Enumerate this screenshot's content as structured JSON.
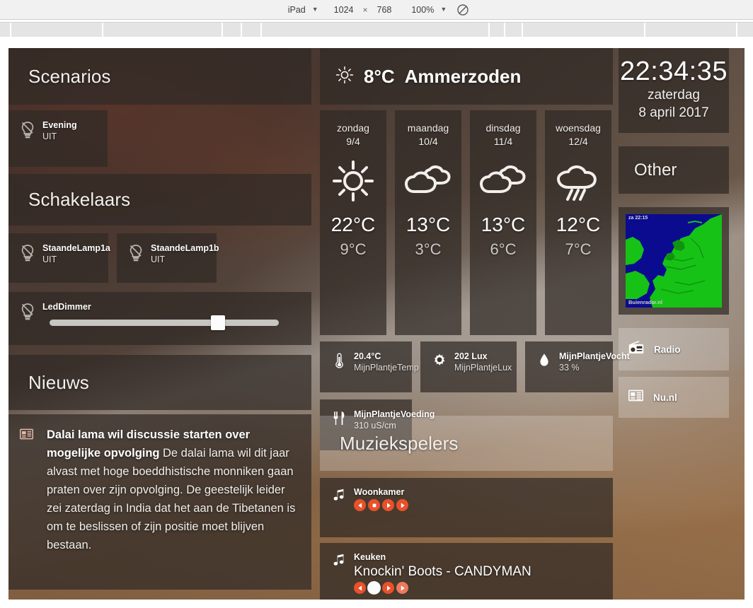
{
  "devtoolbar": {
    "device": "iPad",
    "device_caret": "▼",
    "width": "1024",
    "times": "×",
    "height": "768",
    "zoom": "100%",
    "zoom_caret": "▼",
    "rotate_icon": "rotate-icon"
  },
  "ruler": {
    "ticks": [
      14,
      144,
      313,
      340,
      368,
      690,
      712,
      737,
      910,
      1040
    ]
  },
  "scenarios": {
    "header": "Scenarios",
    "items": [
      {
        "name": "Evening",
        "state": "UIT",
        "icon": "bulb-icon"
      }
    ]
  },
  "switches": {
    "header": "Schakelaars",
    "items": [
      {
        "name": "StaandeLamp1a",
        "state": "UIT",
        "icon": "bulb-icon"
      },
      {
        "name": "StaandeLamp1b",
        "state": "UIT",
        "icon": "bulb-icon"
      }
    ],
    "dimmer": {
      "name": "LedDimmer",
      "icon": "bulb-icon",
      "value_percent": 75
    }
  },
  "weather": {
    "icon": "sun-icon",
    "current_temp": "8°C",
    "city": "Ammerzoden",
    "forecast": [
      {
        "day": "zondag",
        "date": "9/4",
        "icon": "sun-icon",
        "high": "22°C",
        "low": "9°C"
      },
      {
        "day": "maandag",
        "date": "10/4",
        "icon": "clouds-icon",
        "high": "13°C",
        "low": "3°C"
      },
      {
        "day": "dinsdag",
        "date": "11/4",
        "icon": "clouds-icon",
        "high": "13°C",
        "low": "6°C"
      },
      {
        "day": "woensdag",
        "date": "12/4",
        "icon": "rain-icon",
        "high": "12°C",
        "low": "7°C"
      }
    ]
  },
  "sensors": [
    {
      "value": "20.4°C",
      "label": "MijnPlantjeTemp",
      "icon": "thermometer-icon"
    },
    {
      "value": "202 Lux",
      "label": "MijnPlantjeLux",
      "icon": "brightness-icon"
    },
    {
      "value": "MijnPlantjeVocht",
      "label": "33 %",
      "icon": "droplet-icon"
    },
    {
      "value": "MijnPlantjeVoeding",
      "label": "310 uS/cm",
      "icon": "cutlery-icon"
    }
  ],
  "clock": {
    "time": "22:34:35",
    "weekday": "zaterdag",
    "date": "8 april 2017"
  },
  "other": {
    "header": "Other",
    "radar": {
      "timestamp": "za 22:15",
      "watermark": "Buienradar.nl",
      "sea_color": "#0b0b8f",
      "land_color": "#16c216"
    },
    "links": [
      {
        "label": "Radio",
        "icon": "radio-icon"
      },
      {
        "label": "Nu.nl",
        "icon": "newspaper-icon"
      }
    ]
  },
  "news": {
    "header": "Nieuws",
    "article": {
      "icon": "newspaper-icon",
      "title": "Dalai lama wil discussie starten over mogelijke opvolging",
      "body": "De dalai lama wil dit jaar alvast met hoge boeddhistische monniken gaan praten over zijn opvolging. De geestelijk leider zei zaterdag in India dat het aan de Tibetanen is om te beslissen of zijn positie moet blijven bestaan."
    }
  },
  "music": {
    "header": "Muziekspelers",
    "players": [
      {
        "room": "Woonkamer",
        "track": "",
        "icon": "note-icon",
        "controls": [
          "prev-icon",
          "stop-icon",
          "play-icon",
          "next-icon"
        ]
      },
      {
        "room": "Keuken",
        "track": "Knockin' Boots - CANDYMAN",
        "icon": "note-icon",
        "controls": [
          "prev-icon",
          "stop-icon",
          "play-icon",
          "next-icon"
        ]
      }
    ]
  },
  "colors": {
    "accent": "#e8512a",
    "tile": "rgba(48,42,38,0.72)",
    "text": "#ffffff"
  }
}
